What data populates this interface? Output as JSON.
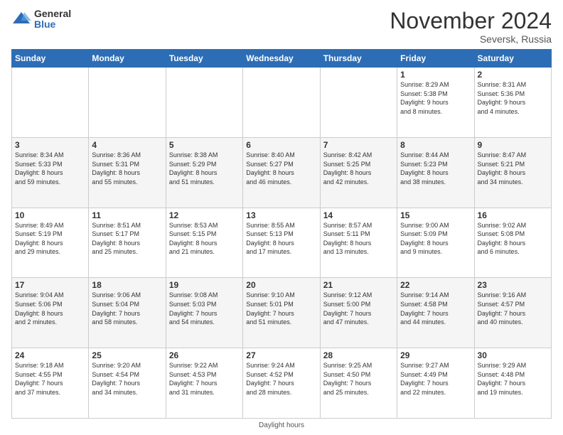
{
  "logo": {
    "general": "General",
    "blue": "Blue"
  },
  "title": "November 2024",
  "location": "Seversk, Russia",
  "days_header": [
    "Sunday",
    "Monday",
    "Tuesday",
    "Wednesday",
    "Thursday",
    "Friday",
    "Saturday"
  ],
  "footer": "Daylight hours",
  "weeks": [
    [
      {
        "day": "",
        "info": ""
      },
      {
        "day": "",
        "info": ""
      },
      {
        "day": "",
        "info": ""
      },
      {
        "day": "",
        "info": ""
      },
      {
        "day": "",
        "info": ""
      },
      {
        "day": "1",
        "info": "Sunrise: 8:29 AM\nSunset: 5:38 PM\nDaylight: 9 hours\nand 8 minutes."
      },
      {
        "day": "2",
        "info": "Sunrise: 8:31 AM\nSunset: 5:36 PM\nDaylight: 9 hours\nand 4 minutes."
      }
    ],
    [
      {
        "day": "3",
        "info": "Sunrise: 8:34 AM\nSunset: 5:33 PM\nDaylight: 8 hours\nand 59 minutes."
      },
      {
        "day": "4",
        "info": "Sunrise: 8:36 AM\nSunset: 5:31 PM\nDaylight: 8 hours\nand 55 minutes."
      },
      {
        "day": "5",
        "info": "Sunrise: 8:38 AM\nSunset: 5:29 PM\nDaylight: 8 hours\nand 51 minutes."
      },
      {
        "day": "6",
        "info": "Sunrise: 8:40 AM\nSunset: 5:27 PM\nDaylight: 8 hours\nand 46 minutes."
      },
      {
        "day": "7",
        "info": "Sunrise: 8:42 AM\nSunset: 5:25 PM\nDaylight: 8 hours\nand 42 minutes."
      },
      {
        "day": "8",
        "info": "Sunrise: 8:44 AM\nSunset: 5:23 PM\nDaylight: 8 hours\nand 38 minutes."
      },
      {
        "day": "9",
        "info": "Sunrise: 8:47 AM\nSunset: 5:21 PM\nDaylight: 8 hours\nand 34 minutes."
      }
    ],
    [
      {
        "day": "10",
        "info": "Sunrise: 8:49 AM\nSunset: 5:19 PM\nDaylight: 8 hours\nand 29 minutes."
      },
      {
        "day": "11",
        "info": "Sunrise: 8:51 AM\nSunset: 5:17 PM\nDaylight: 8 hours\nand 25 minutes."
      },
      {
        "day": "12",
        "info": "Sunrise: 8:53 AM\nSunset: 5:15 PM\nDaylight: 8 hours\nand 21 minutes."
      },
      {
        "day": "13",
        "info": "Sunrise: 8:55 AM\nSunset: 5:13 PM\nDaylight: 8 hours\nand 17 minutes."
      },
      {
        "day": "14",
        "info": "Sunrise: 8:57 AM\nSunset: 5:11 PM\nDaylight: 8 hours\nand 13 minutes."
      },
      {
        "day": "15",
        "info": "Sunrise: 9:00 AM\nSunset: 5:09 PM\nDaylight: 8 hours\nand 9 minutes."
      },
      {
        "day": "16",
        "info": "Sunrise: 9:02 AM\nSunset: 5:08 PM\nDaylight: 8 hours\nand 6 minutes."
      }
    ],
    [
      {
        "day": "17",
        "info": "Sunrise: 9:04 AM\nSunset: 5:06 PM\nDaylight: 8 hours\nand 2 minutes."
      },
      {
        "day": "18",
        "info": "Sunrise: 9:06 AM\nSunset: 5:04 PM\nDaylight: 7 hours\nand 58 minutes."
      },
      {
        "day": "19",
        "info": "Sunrise: 9:08 AM\nSunset: 5:03 PM\nDaylight: 7 hours\nand 54 minutes."
      },
      {
        "day": "20",
        "info": "Sunrise: 9:10 AM\nSunset: 5:01 PM\nDaylight: 7 hours\nand 51 minutes."
      },
      {
        "day": "21",
        "info": "Sunrise: 9:12 AM\nSunset: 5:00 PM\nDaylight: 7 hours\nand 47 minutes."
      },
      {
        "day": "22",
        "info": "Sunrise: 9:14 AM\nSunset: 4:58 PM\nDaylight: 7 hours\nand 44 minutes."
      },
      {
        "day": "23",
        "info": "Sunrise: 9:16 AM\nSunset: 4:57 PM\nDaylight: 7 hours\nand 40 minutes."
      }
    ],
    [
      {
        "day": "24",
        "info": "Sunrise: 9:18 AM\nSunset: 4:55 PM\nDaylight: 7 hours\nand 37 minutes."
      },
      {
        "day": "25",
        "info": "Sunrise: 9:20 AM\nSunset: 4:54 PM\nDaylight: 7 hours\nand 34 minutes."
      },
      {
        "day": "26",
        "info": "Sunrise: 9:22 AM\nSunset: 4:53 PM\nDaylight: 7 hours\nand 31 minutes."
      },
      {
        "day": "27",
        "info": "Sunrise: 9:24 AM\nSunset: 4:52 PM\nDaylight: 7 hours\nand 28 minutes."
      },
      {
        "day": "28",
        "info": "Sunrise: 9:25 AM\nSunset: 4:50 PM\nDaylight: 7 hours\nand 25 minutes."
      },
      {
        "day": "29",
        "info": "Sunrise: 9:27 AM\nSunset: 4:49 PM\nDaylight: 7 hours\nand 22 minutes."
      },
      {
        "day": "30",
        "info": "Sunrise: 9:29 AM\nSunset: 4:48 PM\nDaylight: 7 hours\nand 19 minutes."
      }
    ]
  ]
}
